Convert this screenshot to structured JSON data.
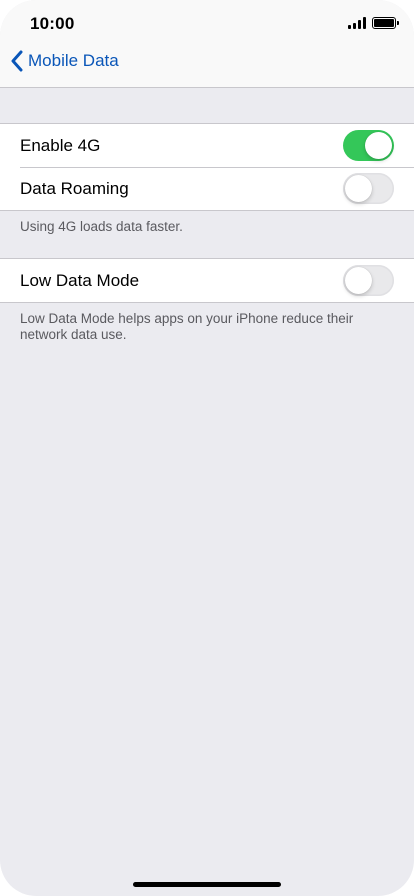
{
  "status_bar": {
    "time": "10:00"
  },
  "nav": {
    "back_label": "Mobile Data"
  },
  "group1": {
    "rows": [
      {
        "label": "Enable 4G",
        "toggle_on": true
      },
      {
        "label": "Data Roaming",
        "toggle_on": false
      }
    ],
    "footnote": "Using 4G loads data faster."
  },
  "group2": {
    "rows": [
      {
        "label": "Low Data Mode",
        "toggle_on": false
      }
    ],
    "footnote": "Low Data Mode helps apps on your iPhone reduce their network data use."
  },
  "colors": {
    "accent": "#0a56b8",
    "toggle_on": "#34c759",
    "background": "#ebebf0"
  }
}
